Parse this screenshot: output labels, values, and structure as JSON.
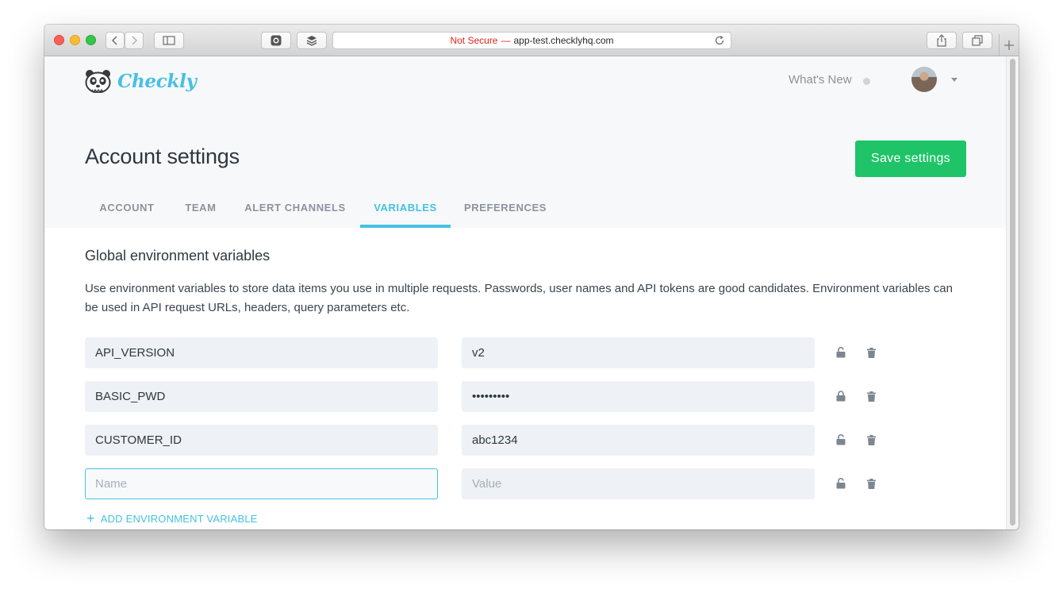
{
  "browser": {
    "url_warning": "Not Secure",
    "url_separator": "—",
    "url_host": "app-test.checklyhq.com"
  },
  "header": {
    "brand": "Checkly",
    "whats_new": "What's New"
  },
  "page": {
    "title": "Account settings",
    "save_label": "Save settings"
  },
  "tabs": [
    {
      "label": "ACCOUNT",
      "active": false
    },
    {
      "label": "TEAM",
      "active": false
    },
    {
      "label": "ALERT CHANNELS",
      "active": false
    },
    {
      "label": "VARIABLES",
      "active": true
    },
    {
      "label": "PREFERENCES",
      "active": false
    }
  ],
  "section": {
    "title": "Global environment variables",
    "description": "Use environment variables to store data items you use in multiple requests. Passwords, user names and API tokens are good candidates. Environment variables can be used in API request URLs, headers, query parameters etc."
  },
  "variables": [
    {
      "name": "API_VERSION",
      "value": "v2",
      "locked": false
    },
    {
      "name": "BASIC_PWD",
      "value": "•••••••••",
      "locked": true
    },
    {
      "name": "CUSTOMER_ID",
      "value": "abc1234",
      "locked": false
    }
  ],
  "new_variable": {
    "name_placeholder": "Name",
    "value_placeholder": "Value"
  },
  "add_variable_label": "ADD ENVIRONMENT VARIABLE",
  "colors": {
    "accent": "#45c1e2",
    "save_button": "#1ec467",
    "title_text": "#2d3840"
  }
}
